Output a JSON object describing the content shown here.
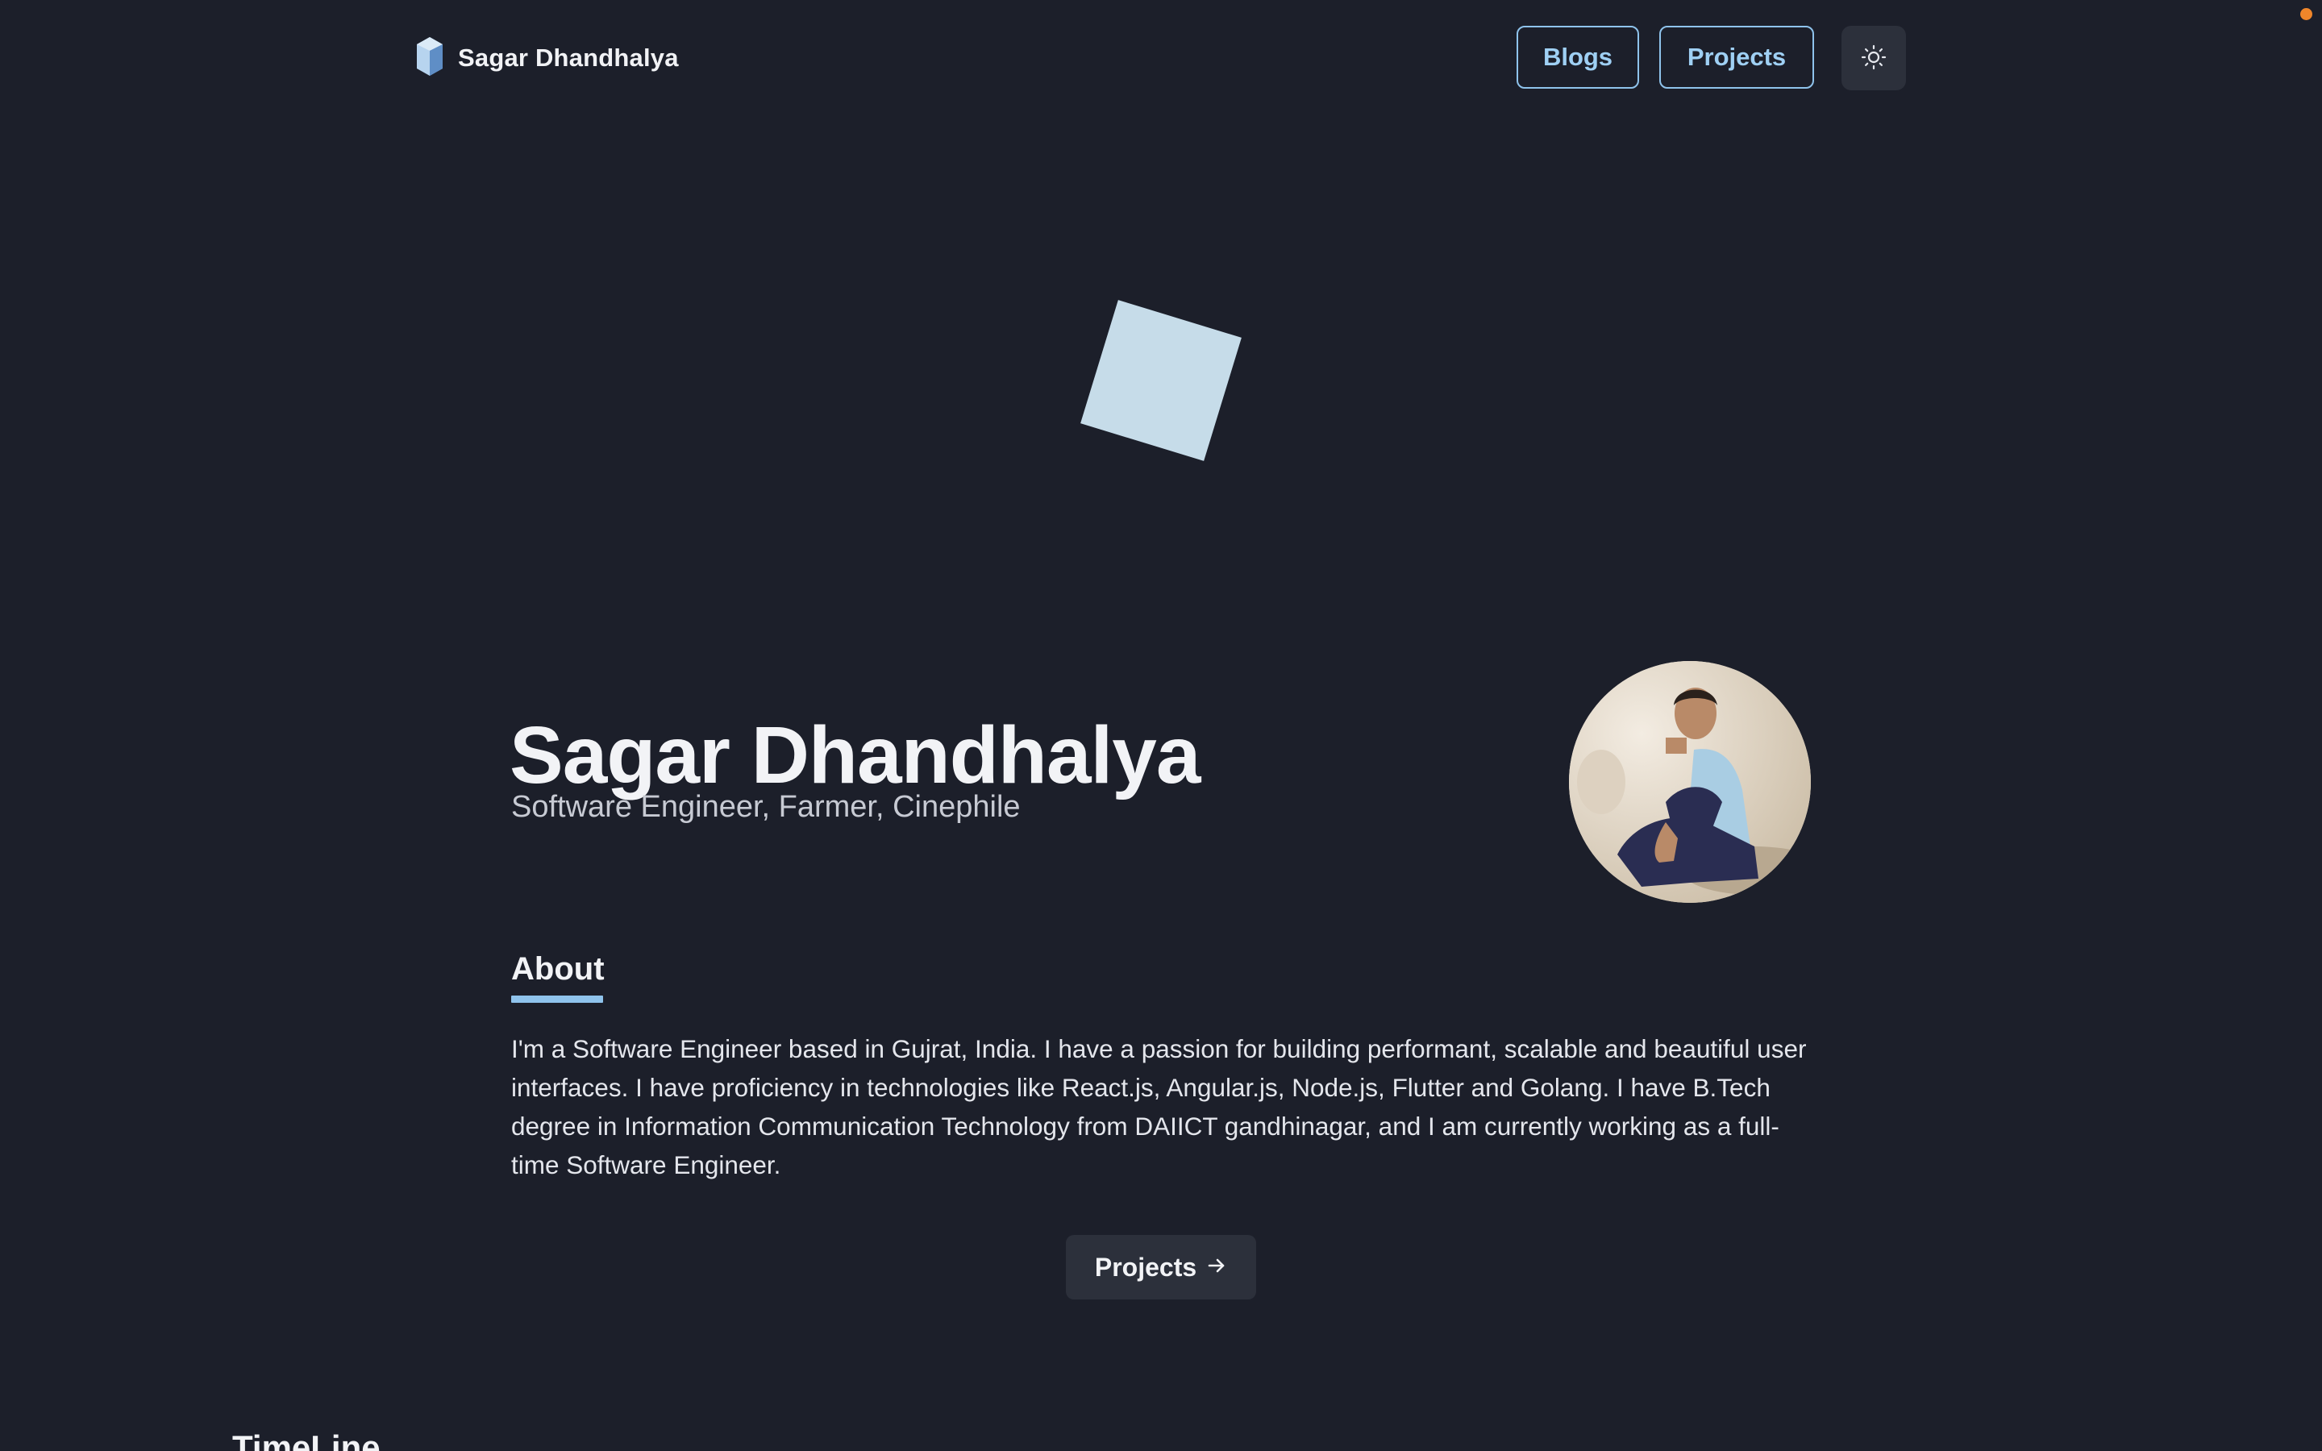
{
  "header": {
    "brand_name": "Sagar Dhandhalya",
    "brand_icon": "crystal-logo-icon",
    "nav": [
      {
        "label": "Blogs"
      },
      {
        "label": "Projects"
      }
    ],
    "theme_toggle_icon": "sun-icon"
  },
  "hero": {
    "decoration": "rotating-cube",
    "name": "Sagar Dhandhalya",
    "tagline": "Software Engineer, Farmer, Cinephile",
    "avatar_alt": "profile-photo"
  },
  "about": {
    "heading": "About",
    "text": "I'm a Software Engineer based in Gujrat, India. I have a passion for building performant, scalable and beautiful user interfaces. I have proficiency in technologies like React.js, Angular.js, Node.js, Flutter and Golang. I have B.Tech degree in Information Communication Technology from DAIICT gandhinagar, and I am currently working as a full-time Software Engineer."
  },
  "cta": {
    "label": "Projects",
    "icon": "arrow-right-icon"
  },
  "timeline": {
    "heading": "TimeLine"
  },
  "colors": {
    "background": "#1c1f2a",
    "accent": "#8fc3ec",
    "button_bg": "#2c303b",
    "cube": "#c6dce9",
    "notification_dot": "#f0862a"
  }
}
